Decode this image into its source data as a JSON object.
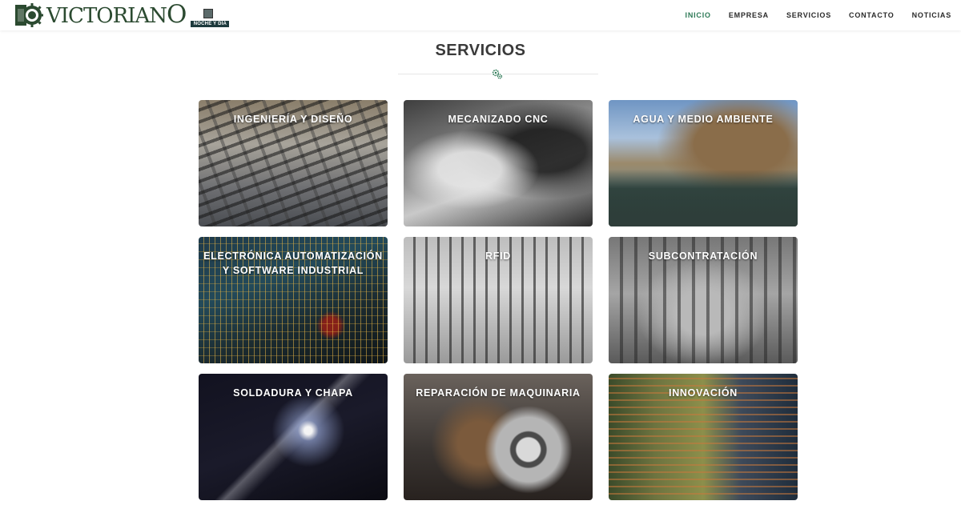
{
  "header": {
    "logo_text_main": "VICTORIAN",
    "logo_text_end": "O",
    "badge_label": "NOCHE Y DÍA"
  },
  "nav": {
    "items": [
      {
        "label": "INICIO",
        "active": true
      },
      {
        "label": "EMPRESA",
        "active": false
      },
      {
        "label": "SERVICIOS",
        "active": false
      },
      {
        "label": "CONTACTO",
        "active": false
      },
      {
        "label": "NOTICIAS",
        "active": false
      }
    ]
  },
  "section": {
    "title": "SERVICIOS",
    "divider_icon": "gears-icon"
  },
  "services": [
    {
      "title": "INGENIERÍA Y DISEÑO"
    },
    {
      "title": "MECANIZADO CNC"
    },
    {
      "title": "AGUA Y MEDIO AMBIENTE"
    },
    {
      "title": "ELECTRÓNICA AUTOMATIZACIÓN Y SOFTWARE INDUSTRIAL"
    },
    {
      "title": "RFID"
    },
    {
      "title": "SUBCONTRATACIÓN"
    },
    {
      "title": "SOLDADURA Y CHAPA"
    },
    {
      "title": "REPARACIÓN DE MAQUINARIA"
    },
    {
      "title": "INNOVACIÓN"
    }
  ],
  "colors": {
    "accent": "#2e7a57",
    "logo": "#2b4a30",
    "title": "#3a3a3a"
  }
}
